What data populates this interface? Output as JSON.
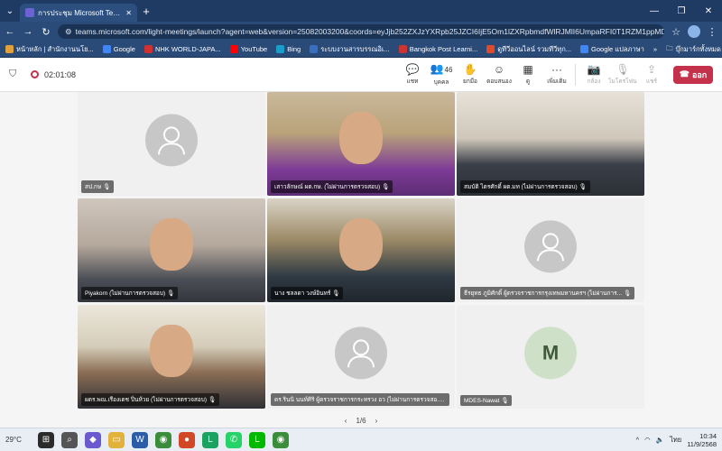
{
  "browser": {
    "tab_title": "การประชุม Microsoft Teams | Micr...",
    "url": "teams.microsoft.com/light-meetings/launch?agent=web&version=25082003200&coords=eyJjb252ZXJzYXRpb25JZCI6IjE5Om1lZXRpbmdfWlRJMlI6UmpaRFI0T1RZM1ppMDBZekF5TFRne...",
    "bookmarks": [
      {
        "label": "หน้าหลัก | สำนักงานนโย...",
        "color": "#e0a13a"
      },
      {
        "label": "Google",
        "color": "#4285f4"
      },
      {
        "label": "NHK WORLD-JAPA...",
        "color": "#d03030"
      },
      {
        "label": "YouTube",
        "color": "#ff0000"
      },
      {
        "label": "Bing",
        "color": "#1a9ec9"
      },
      {
        "label": "ระบบงานสารบรรณอิเ...",
        "color": "#3a6fbf"
      },
      {
        "label": "Bangkok Post Learni...",
        "color": "#c33"
      },
      {
        "label": "ดูทีวีออนไลน์ รวมทีวีทุก...",
        "color": "#e04a2a"
      },
      {
        "label": "Google แปลภาษา",
        "color": "#4285f4"
      }
    ],
    "bookmarks_folder": "บุ๊กมาร์กทั้งหมด"
  },
  "toolbar": {
    "timer": "02:01:08",
    "tools": [
      {
        "icon": "chat-icon",
        "glyph": "💬",
        "label": "แชท",
        "disabled": false
      },
      {
        "icon": "people-icon",
        "glyph": "👥",
        "label": "บุคคล",
        "count": "46",
        "disabled": false
      },
      {
        "icon": "raise-hand-icon",
        "glyph": "✋",
        "label": "ยกมือ",
        "disabled": false
      },
      {
        "icon": "react-icon",
        "glyph": "☺",
        "label": "ตอบสนอง",
        "disabled": false
      },
      {
        "icon": "view-icon",
        "glyph": "▦",
        "label": "ดู",
        "disabled": false
      },
      {
        "icon": "more-icon",
        "glyph": "···",
        "label": "เพิ่มเติม",
        "disabled": false
      },
      {
        "icon": "camera-icon",
        "glyph": "📷",
        "label": "กล้อง",
        "disabled": true
      },
      {
        "icon": "mic-icon",
        "glyph": "🎙",
        "label": "ไมโครโฟน",
        "disabled": true
      },
      {
        "icon": "share-icon",
        "glyph": "⇪",
        "label": "แชร์",
        "disabled": true
      }
    ],
    "leave_label": "ออก"
  },
  "participants": [
    {
      "name": "สป.กษ",
      "type": "avatar"
    },
    {
      "name": "เสาวลักษณ์ ผต.กษ. (ไม่ผ่านการตรวจสอบ)",
      "type": "camera"
    },
    {
      "name": "สมบัติ ไตรศักดิ์ ผต.มท (ไม่ผ่านการตรวจสอบ)",
      "type": "camera"
    },
    {
      "name": "Piyakorn (ไม่ผ่านการตรวจสอบ)",
      "type": "camera"
    },
    {
      "name": "นาง ชลลดา วงษ์อินทร์",
      "type": "camera"
    },
    {
      "name": "ธีรยุทธ ภูมิศักดิ์ ผู้ตรวจราชการกรุงเทพมหานครฯ (ไม่ผ่านการ...",
      "type": "avatar"
    },
    {
      "name": "ผตร.พณ.เรืองเดช ปิ่นห้วย (ไม่ผ่านการตรวจสอบ)",
      "type": "camera"
    },
    {
      "name": "ดร.รินนิ นนท์ศิริ ผู้ตรวจราชการกระทรวง อว (ไม่ผ่านการตรวจสอ...",
      "type": "avatar"
    },
    {
      "name": "MDES-Nawat",
      "type": "initial",
      "initial": "M"
    }
  ],
  "pager": {
    "label": "1/6"
  },
  "taskbar": {
    "weather": "29°C",
    "lang": "ไทย",
    "time": "10:34",
    "date": "11/9/2568"
  }
}
